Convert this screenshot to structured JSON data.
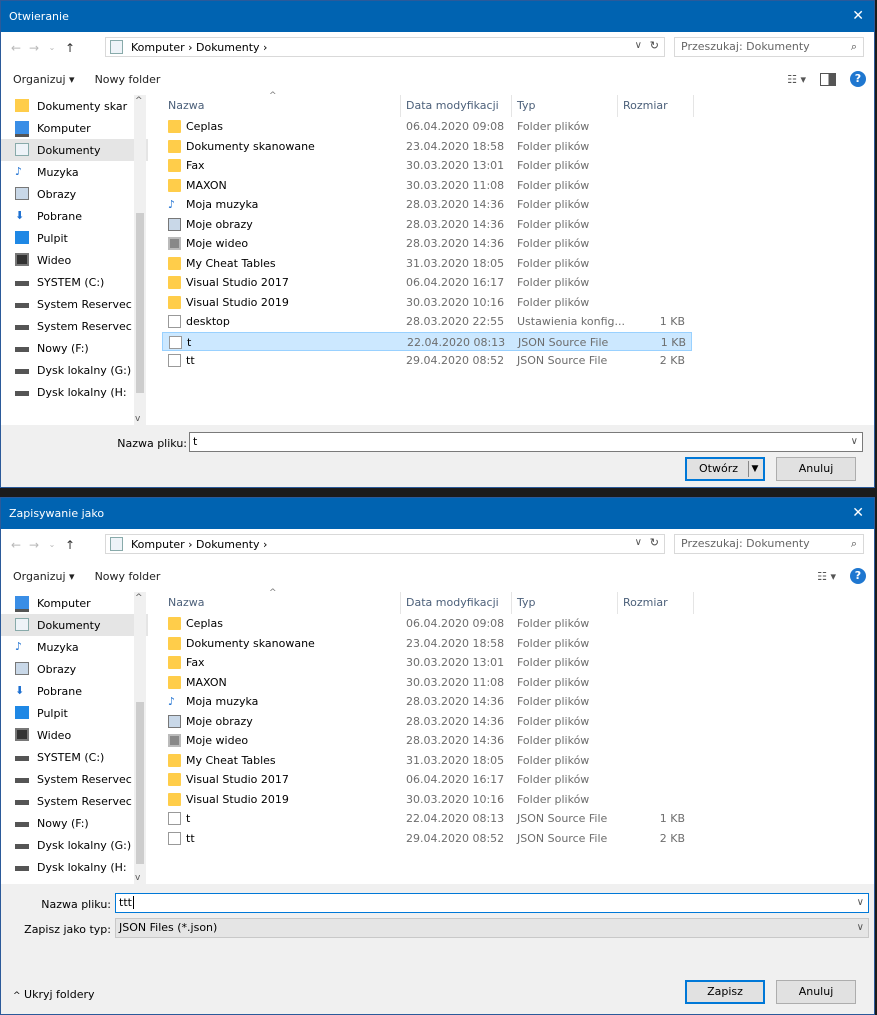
{
  "open_dialog": {
    "title": "Otwieranie",
    "breadcrumb": "Komputer  ›  Dokumenty  ›",
    "search_placeholder": "Przeszukaj: Dokumenty",
    "toolbar": {
      "organize": "Organizuj ▾",
      "new_folder": "Nowy folder"
    },
    "nav": [
      {
        "label": "Dokumenty skar",
        "icon": "folder-icon"
      },
      {
        "label": "Komputer",
        "icon": "computer-icon"
      },
      {
        "label": "Dokumenty",
        "icon": "documents-icon"
      },
      {
        "label": "Muzyka",
        "icon": "music-icon"
      },
      {
        "label": "Obrazy",
        "icon": "pictures-icon"
      },
      {
        "label": "Pobrane",
        "icon": "download-icon"
      },
      {
        "label": "Pulpit",
        "icon": "desktop-icon"
      },
      {
        "label": "Wideo",
        "icon": "video-icon"
      },
      {
        "label": "SYSTEM (C:)",
        "icon": "drive-icon"
      },
      {
        "label": "System Reservec",
        "icon": "drive-icon"
      },
      {
        "label": "System Reservec",
        "icon": "drive-icon"
      },
      {
        "label": "Nowy (F:)",
        "icon": "drive-icon"
      },
      {
        "label": "Dysk lokalny (G:)",
        "icon": "drive-icon"
      },
      {
        "label": "Dysk lokalny (H:",
        "icon": "drive-icon"
      }
    ],
    "columns": {
      "name": "Nazwa",
      "date": "Data modyfikacji",
      "type": "Typ",
      "size": "Rozmiar"
    },
    "files": [
      {
        "name": "Ceplas",
        "date": "06.04.2020 09:08",
        "type": "Folder plików",
        "size": ""
      },
      {
        "name": "Dokumenty skanowane",
        "date": "23.04.2020 18:58",
        "type": "Folder plików",
        "size": ""
      },
      {
        "name": "Fax",
        "date": "30.03.2020 13:01",
        "type": "Folder plików",
        "size": ""
      },
      {
        "name": "MAXON",
        "date": "30.03.2020 11:08",
        "type": "Folder plików",
        "size": ""
      },
      {
        "name": "Moja muzyka",
        "date": "28.03.2020 14:36",
        "type": "Folder plików",
        "size": ""
      },
      {
        "name": "Moje obrazy",
        "date": "28.03.2020 14:36",
        "type": "Folder plików",
        "size": ""
      },
      {
        "name": "Moje wideo",
        "date": "28.03.2020 14:36",
        "type": "Folder plików",
        "size": ""
      },
      {
        "name": "My Cheat Tables",
        "date": "31.03.2020 18:05",
        "type": "Folder plików",
        "size": ""
      },
      {
        "name": "Visual Studio 2017",
        "date": "06.04.2020 16:17",
        "type": "Folder plików",
        "size": ""
      },
      {
        "name": "Visual Studio 2019",
        "date": "30.03.2020 10:16",
        "type": "Folder plików",
        "size": ""
      },
      {
        "name": "desktop",
        "date": "28.03.2020 22:55",
        "type": "Ustawienia konfig...",
        "size": "1 KB"
      },
      {
        "name": "t",
        "date": "22.04.2020 08:13",
        "type": "JSON Source File",
        "size": "1 KB"
      },
      {
        "name": "tt",
        "date": "29.04.2020 08:52",
        "type": "JSON Source File",
        "size": "2 KB"
      }
    ],
    "filename_label": "Nazwa pliku:",
    "filename_value": "t",
    "open_button": "Otwórz",
    "cancel_button": "Anuluj"
  },
  "save_dialog": {
    "title": "Zapisywanie jako",
    "breadcrumb": "Komputer  ›  Dokumenty  ›",
    "search_placeholder": "Przeszukaj: Dokumenty",
    "toolbar": {
      "organize": "Organizuj ▾",
      "new_folder": "Nowy folder"
    },
    "nav": [
      {
        "label": "Komputer",
        "icon": "computer-icon"
      },
      {
        "label": "Dokumenty",
        "icon": "documents-icon"
      },
      {
        "label": "Muzyka",
        "icon": "music-icon"
      },
      {
        "label": "Obrazy",
        "icon": "pictures-icon"
      },
      {
        "label": "Pobrane",
        "icon": "download-icon"
      },
      {
        "label": "Pulpit",
        "icon": "desktop-icon"
      },
      {
        "label": "Wideo",
        "icon": "video-icon"
      },
      {
        "label": "SYSTEM (C:)",
        "icon": "drive-icon"
      },
      {
        "label": "System Reservec",
        "icon": "drive-icon"
      },
      {
        "label": "System Reservec",
        "icon": "drive-icon"
      },
      {
        "label": "Nowy (F:)",
        "icon": "drive-icon"
      },
      {
        "label": "Dysk lokalny (G:)",
        "icon": "drive-icon"
      },
      {
        "label": "Dysk lokalny (H:",
        "icon": "drive-icon"
      }
    ],
    "columns": {
      "name": "Nazwa",
      "date": "Data modyfikacji",
      "type": "Typ",
      "size": "Rozmiar"
    },
    "files": [
      {
        "name": "Ceplas",
        "date": "06.04.2020 09:08",
        "type": "Folder plików",
        "size": ""
      },
      {
        "name": "Dokumenty skanowane",
        "date": "23.04.2020 18:58",
        "type": "Folder plików",
        "size": ""
      },
      {
        "name": "Fax",
        "date": "30.03.2020 13:01",
        "type": "Folder plików",
        "size": ""
      },
      {
        "name": "MAXON",
        "date": "30.03.2020 11:08",
        "type": "Folder plików",
        "size": ""
      },
      {
        "name": "Moja muzyka",
        "date": "28.03.2020 14:36",
        "type": "Folder plików",
        "size": ""
      },
      {
        "name": "Moje obrazy",
        "date": "28.03.2020 14:36",
        "type": "Folder plików",
        "size": ""
      },
      {
        "name": "Moje wideo",
        "date": "28.03.2020 14:36",
        "type": "Folder plików",
        "size": ""
      },
      {
        "name": "My Cheat Tables",
        "date": "31.03.2020 18:05",
        "type": "Folder plików",
        "size": ""
      },
      {
        "name": "Visual Studio 2017",
        "date": "06.04.2020 16:17",
        "type": "Folder plików",
        "size": ""
      },
      {
        "name": "Visual Studio 2019",
        "date": "30.03.2020 10:16",
        "type": "Folder plików",
        "size": ""
      },
      {
        "name": "t",
        "date": "22.04.2020 08:13",
        "type": "JSON Source File",
        "size": "1 KB"
      },
      {
        "name": "tt",
        "date": "29.04.2020 08:52",
        "type": "JSON Source File",
        "size": "2 KB"
      }
    ],
    "filename_label": "Nazwa pliku:",
    "filename_value": "ttt",
    "filetype_label": "Zapisz jako typ:",
    "filetype_value": "JSON Files (*.json)",
    "hide_folders": "Ukryj foldery",
    "save_button": "Zapisz",
    "cancel_button": "Anuluj"
  }
}
